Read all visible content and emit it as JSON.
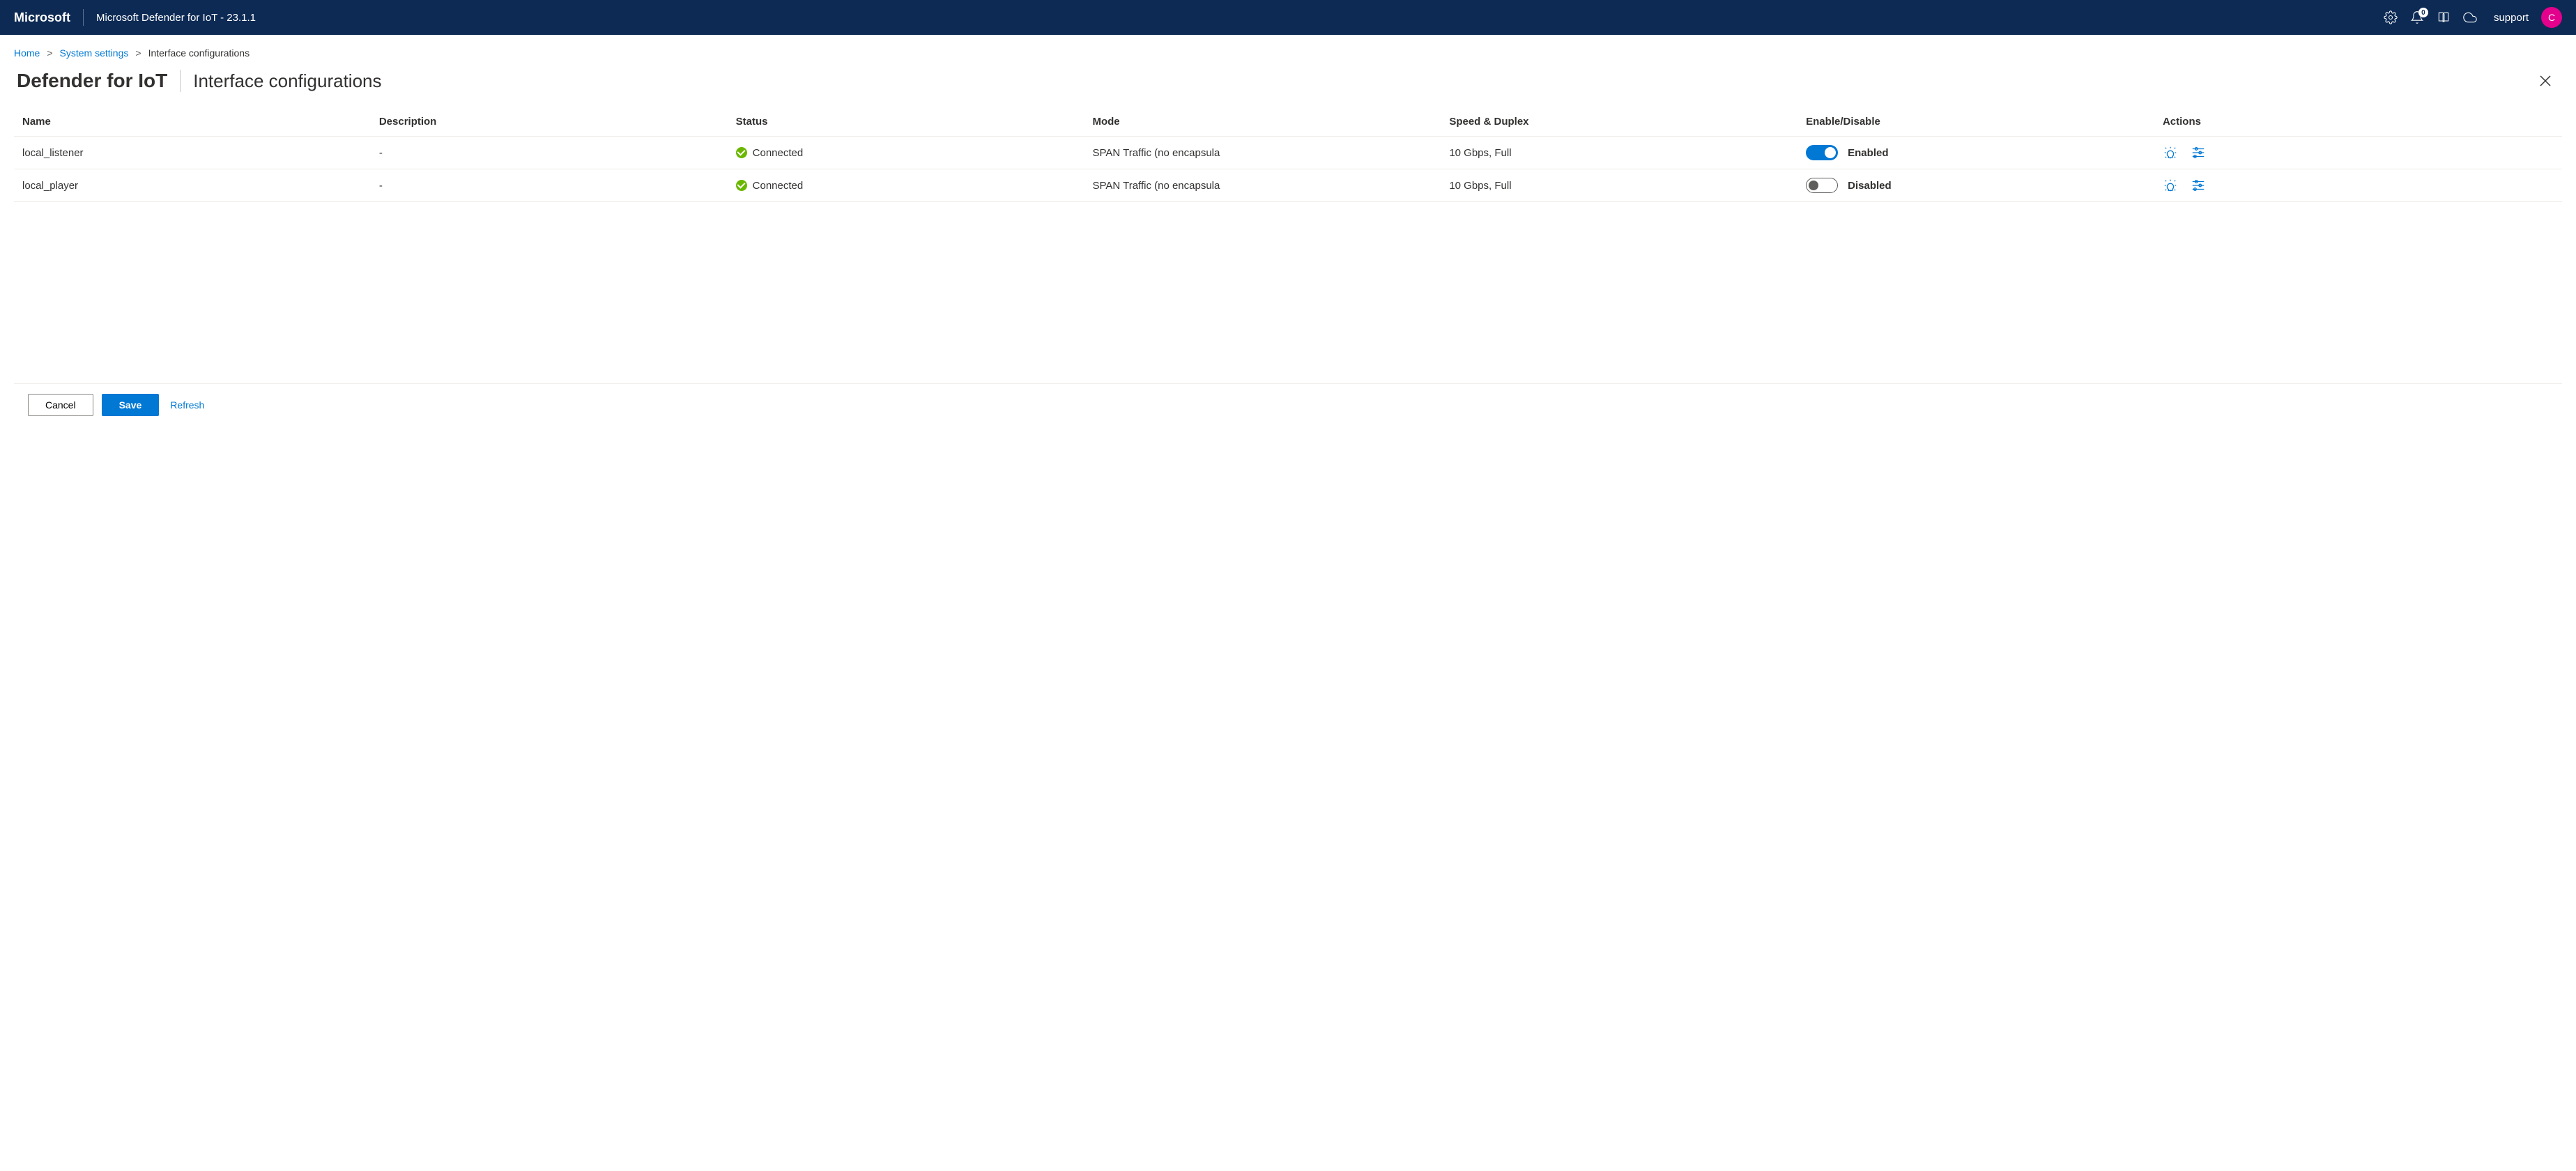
{
  "topbar": {
    "brand": "Microsoft",
    "app_title": "Microsoft Defender for IoT - 23.1.1",
    "notif_count": "0",
    "user_label": "support",
    "avatar_initial": "C"
  },
  "breadcrumbs": {
    "home": "Home",
    "system_settings": "System settings",
    "current": "Interface configurations"
  },
  "page": {
    "title": "Defender for IoT",
    "subtitle": "Interface configurations"
  },
  "table": {
    "headers": {
      "name": "Name",
      "description": "Description",
      "status": "Status",
      "mode": "Mode",
      "speed": "Speed & Duplex",
      "enable": "Enable/Disable",
      "actions": "Actions"
    },
    "rows": [
      {
        "name": "local_listener",
        "description": "-",
        "status": "Connected",
        "mode": "SPAN Traffic (no encapsula",
        "speed": "10 Gbps, Full",
        "enabled": true,
        "enable_label": "Enabled"
      },
      {
        "name": "local_player",
        "description": "-",
        "status": "Connected",
        "mode": "SPAN Traffic (no encapsula",
        "speed": "10 Gbps, Full",
        "enabled": false,
        "enable_label": "Disabled"
      }
    ]
  },
  "footer": {
    "cancel": "Cancel",
    "save": "Save",
    "refresh": "Refresh"
  }
}
